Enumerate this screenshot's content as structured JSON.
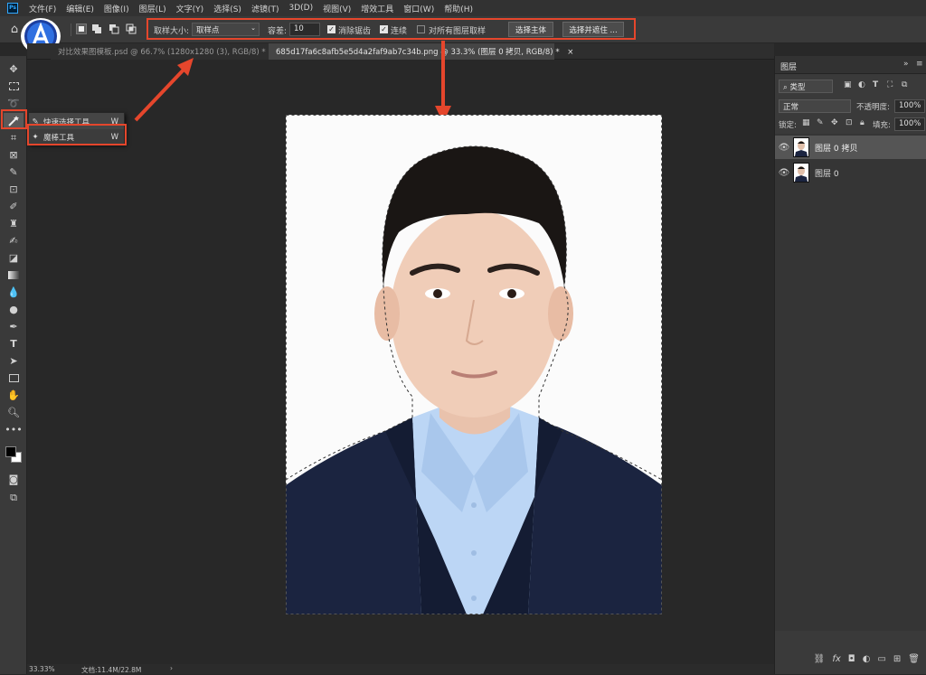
{
  "menubar": {
    "logo": "Ps",
    "items": [
      "文件(F)",
      "编辑(E)",
      "图像(I)",
      "图层(L)",
      "文字(Y)",
      "选择(S)",
      "滤镜(T)",
      "3D(D)",
      "视图(V)",
      "增效工具",
      "窗口(W)",
      "帮助(H)"
    ]
  },
  "options": {
    "sample_size_label": "取样大小:",
    "sample_size_value": "取样点",
    "tolerance_label": "容差:",
    "tolerance_value": "10",
    "antialias_label": "消除锯齿",
    "contiguous_label": "连续",
    "all_layers_label": "对所有图层取样",
    "select_subject_label": "选择主体",
    "select_mask_label": "选择并遮住 ..."
  },
  "tabs": [
    {
      "label": "对比效果图模板.psd @ 66.7% (1280x1280 (3), RGB/8) *",
      "close": "×"
    },
    {
      "label": "685d17fa6c8afb5e5d4a2faf9ab7c34b.png @ 33.3% (图层 0 拷贝, RGB/8) *",
      "close": "×"
    }
  ],
  "flyout": {
    "items": [
      {
        "label": "快速选择工具",
        "shortcut": "W"
      },
      {
        "label": "魔棒工具",
        "shortcut": "W"
      }
    ]
  },
  "layers_panel": {
    "title": "图层",
    "filter_kind": "类型",
    "blend_mode": "正常",
    "opacity_label": "不透明度:",
    "opacity_value": "100%",
    "lock_label": "锁定:",
    "fill_label": "填充:",
    "fill_value": "100%",
    "layers": [
      {
        "name": "图层 0 拷贝",
        "selected": true
      },
      {
        "name": "图层 0",
        "selected": false
      }
    ],
    "bottom_icons": [
      "link-icon",
      "fx-icon",
      "mask-icon",
      "adjustment-icon",
      "folder-icon",
      "new-layer-icon",
      "trash-icon"
    ]
  },
  "status": {
    "zoom": "33.33%",
    "doc": "文档:11.4M/22.8M"
  },
  "colors": {
    "highlight": "#e5462c",
    "app_bg": "#282828",
    "panel_bg": "#3a3a3a"
  }
}
